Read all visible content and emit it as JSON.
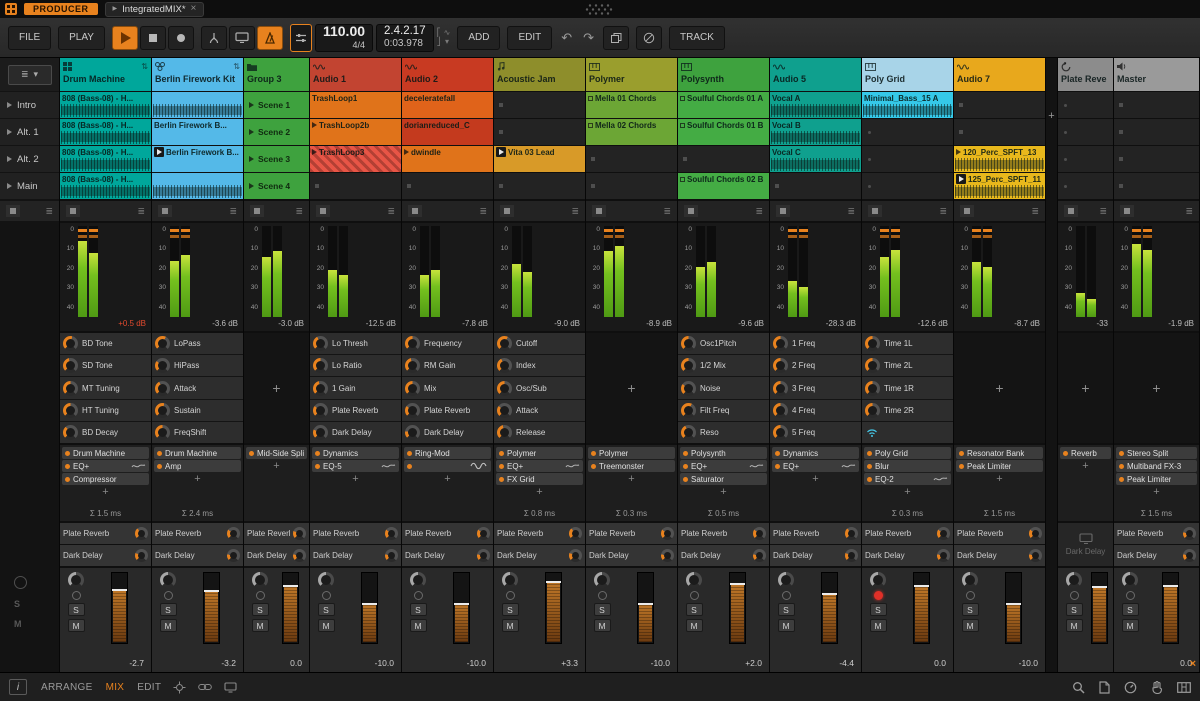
{
  "titlebar": {
    "badge": "PRODUCER",
    "tab": {
      "label": "IntegratedMIX*",
      "close": "×"
    }
  },
  "toolbar": {
    "file": "FILE",
    "play": "PLAY",
    "tempo": "110.00",
    "time_sig": "4/4",
    "position": "2.4.2.17",
    "time": "0:03.978",
    "add": "ADD",
    "edit": "EDIT",
    "track": "TRACK"
  },
  "glyphs": {
    "plus": "+",
    "scene_stop": "≣",
    "solo": "S",
    "mute": "M",
    "info": "i",
    "undo": "↶",
    "redo": "↷",
    "menu": "≣",
    "dropdown": "▾",
    "close": "×",
    "play_tri": "▶",
    "io": "⇅",
    "punch_in": "⎡",
    "punch_out": "⎦",
    "groove": "∿"
  },
  "meter_scale": [
    "0",
    "10",
    "20",
    "30",
    "40"
  ],
  "scenes": [
    "Intro",
    "Alt. 1",
    "Alt. 2",
    "Main"
  ],
  "statusbar": {
    "views": [
      {
        "label": "ARRANGE",
        "active": false
      },
      {
        "label": "MIX",
        "active": true
      },
      {
        "label": "EDIT",
        "active": false
      }
    ]
  },
  "tracks": [
    {
      "name": "Drum Machine",
      "kind": "instrument",
      "icon": "drum-machine",
      "color": "#00A79B",
      "io": true,
      "clips": [
        {
          "type": "clip",
          "label": "808 (Bass-08) - H...",
          "color": "#00A79B",
          "wave": true
        },
        {
          "type": "clip",
          "label": "808 (Bass-08) - H...",
          "color": "#00A79B",
          "wave": true
        },
        {
          "type": "clip",
          "label": "808 (Bass-08) - H...",
          "color": "#00A79B",
          "wave": true
        },
        {
          "type": "clip",
          "label": "808 (Bass-08) - H...",
          "color": "#00A79B",
          "wave": true
        }
      ],
      "meter": {
        "db": "+0.5 dB",
        "hot": true,
        "l": 0.84,
        "r": 0.7,
        "peak": true
      },
      "macros": [
        {
          "label": "BD Tone",
          "amt": 0.55
        },
        {
          "label": "SD Tone",
          "amt": 0.45
        },
        {
          "label": "MT Tuning",
          "amt": 0.5
        },
        {
          "label": "HT Tuning",
          "amt": 0.5
        },
        {
          "label": "BD Decay",
          "amt": 0.35
        }
      ],
      "devices": [
        {
          "label": "Drum Machine"
        },
        {
          "label": "EQ+",
          "eq": true
        },
        {
          "label": "Compressor"
        }
      ],
      "latency": "Σ 1.5 ms",
      "sends": [
        {
          "label": "Plate Reverb",
          "amt": 0.35
        },
        {
          "label": "Dark Delay",
          "amt": 0.25
        }
      ],
      "strip": {
        "value": "-2.7",
        "fader": 0.76,
        "armed": false
      }
    },
    {
      "name": "Berlin Firework Kit",
      "kind": "instrument",
      "icon": "drum-kit",
      "color": "#54B9E8",
      "io": true,
      "clips": [
        {
          "type": "clip",
          "label": "",
          "color": "#54B9E8",
          "wave": true
        },
        {
          "type": "clip",
          "label": "Berlin Firework B...",
          "color": "#54B9E8"
        },
        {
          "type": "clip",
          "label": "Berlin Firework B...",
          "color": "#54B9E8",
          "playing": true
        },
        {
          "type": "clip",
          "label": "",
          "color": "#54B9E8",
          "wave": true
        }
      ],
      "meter": {
        "db": "-3.6 dB",
        "l": 0.62,
        "r": 0.68,
        "peak": true
      },
      "macros": [
        {
          "label": "LoPass",
          "amt": 0.6
        },
        {
          "label": "HiPass",
          "amt": 0.3
        },
        {
          "label": "Attack",
          "amt": 0.4
        },
        {
          "label": "Sustain",
          "amt": 0.55
        },
        {
          "label": "FreqShift",
          "amt": 0.5
        }
      ],
      "devices": [
        {
          "label": "Drum Machine"
        },
        {
          "label": "Amp"
        }
      ],
      "latency": "Σ 2.4 ms",
      "sends": [
        {
          "label": "Plate Reverb",
          "amt": 0.3
        },
        {
          "label": "Dark Delay",
          "amt": 0.2
        }
      ],
      "strip": {
        "value": "-3.2",
        "fader": 0.75,
        "armed": false
      }
    },
    {
      "name": "Group 3",
      "kind": "group",
      "icon": "folder",
      "color": "#3EA23E",
      "clips": [
        {
          "type": "scene",
          "label": "Scene 1"
        },
        {
          "type": "scene",
          "label": "Scene 2"
        },
        {
          "type": "scene",
          "label": "Scene 3"
        },
        {
          "type": "scene",
          "label": "Scene 4"
        }
      ],
      "meter": {
        "db": "-3.0 dB",
        "l": 0.66,
        "r": 0.72
      },
      "macros": [],
      "devices": [
        {
          "label": "Mid-Side Split"
        }
      ],
      "latency": null,
      "sends": [
        {
          "label": "Plate Reverb",
          "amt": 0.25
        },
        {
          "label": "Dark Delay",
          "amt": 0.2
        }
      ],
      "strip": {
        "value": "0.0",
        "fader": 0.82,
        "armed": false
      }
    },
    {
      "name": "Audio 1",
      "kind": "audio",
      "icon": "audio",
      "color": "#C24431",
      "clips": [
        {
          "type": "clip",
          "label": "TrashLoop1",
          "color": "#E0731A"
        },
        {
          "type": "clip",
          "label": "TrashLoop2b",
          "color": "#E0731A",
          "arrow": true
        },
        {
          "type": "clip",
          "label": "TrashLoop3",
          "color": "#E85546",
          "arrow": true,
          "striped": true
        },
        {
          "type": "empty"
        }
      ],
      "meter": {
        "db": "-12.5 dB",
        "l": 0.52,
        "r": 0.46
      },
      "macros": [
        {
          "label": "Lo Thresh",
          "amt": 0.4
        },
        {
          "label": "Lo Ratio",
          "amt": 0.5
        },
        {
          "label": "1 Gain",
          "amt": 0.45
        },
        {
          "label": "Plate Reverb",
          "amt": 0.3
        },
        {
          "label": "Dark Delay",
          "amt": 0.25
        }
      ],
      "devices": [
        {
          "label": "Dynamics"
        },
        {
          "label": "EQ-5",
          "eq": true
        }
      ],
      "latency": null,
      "sends": [
        {
          "label": "Plate Reverb",
          "amt": 0.3
        },
        {
          "label": "Dark Delay",
          "amt": 0.2
        }
      ],
      "strip": {
        "value": "-10.0",
        "fader": 0.56,
        "armed": false
      }
    },
    {
      "name": "Audio 2",
      "kind": "audio",
      "icon": "audio",
      "color": "#C83A22",
      "clips": [
        {
          "type": "clip",
          "label": "deceleratefall",
          "color": "#E0631A"
        },
        {
          "type": "clip",
          "label": "dorianreduced_C",
          "color": "#C43A1E"
        },
        {
          "type": "clip",
          "label": "dwindle",
          "color": "#E0731A",
          "arrow": true
        },
        {
          "type": "empty"
        }
      ],
      "meter": {
        "db": "-7.8 dB",
        "l": 0.46,
        "r": 0.52
      },
      "macros": [
        {
          "label": "Frequency",
          "amt": 0.5
        },
        {
          "label": "RM Gain",
          "amt": 0.45
        },
        {
          "label": "Mix",
          "amt": 0.5
        },
        {
          "label": "Plate Reverb",
          "amt": 0.3
        },
        {
          "label": "Dark Delay",
          "amt": 0.2
        }
      ],
      "devices": [
        {
          "label": "Ring-Mod"
        },
        {
          "label": "",
          "icon": "sine"
        }
      ],
      "latency": null,
      "sends": [
        {
          "label": "Plate Reverb",
          "amt": 0.3
        },
        {
          "label": "Dark Delay",
          "amt": 0.2
        }
      ],
      "strip": {
        "value": "-10.0",
        "fader": 0.56,
        "armed": false
      }
    },
    {
      "name": "Acoustic Jam",
      "kind": "instrument",
      "icon": "note",
      "color": "#8E8E2B",
      "clips": [
        {
          "type": "empty"
        },
        {
          "type": "empty"
        },
        {
          "type": "clip",
          "label": "Vita 03 Lead",
          "color": "#D89A28",
          "playing": true
        },
        {
          "type": "empty"
        }
      ],
      "meter": {
        "db": "-9.0 dB",
        "l": 0.58,
        "r": 0.5
      },
      "macros": [
        {
          "label": "Cutoff",
          "amt": 0.6
        },
        {
          "label": "Index",
          "amt": 0.4
        },
        {
          "label": "Osc/Sub",
          "amt": 0.5
        },
        {
          "label": "Attack",
          "amt": 0.3
        },
        {
          "label": "Release",
          "amt": 0.45
        }
      ],
      "devices": [
        {
          "label": "Polymer"
        },
        {
          "label": "EQ+",
          "eq": true
        },
        {
          "label": "FX Grid"
        }
      ],
      "latency": "Σ 0.8 ms",
      "sends": [
        {
          "label": "Plate Reverb",
          "amt": 0.35
        },
        {
          "label": "Dark Delay",
          "amt": 0.25
        }
      ],
      "strip": {
        "value": "+3.3",
        "fader": 0.87,
        "armed": false
      }
    },
    {
      "name": "Polymer",
      "kind": "instrument",
      "icon": "synth",
      "color": "#9A9E2D",
      "clips": [
        {
          "type": "clip",
          "label": "Mella 01 Chords",
          "color": "#6CA635",
          "square": true
        },
        {
          "type": "clip",
          "label": "Mella 02 Chords",
          "color": "#6CA635",
          "square": true
        },
        {
          "type": "empty"
        },
        {
          "type": "empty"
        }
      ],
      "meter": {
        "db": "-8.9 dB",
        "l": 0.72,
        "r": 0.78,
        "peak": true
      },
      "macros": [],
      "devices": [
        {
          "label": "Polymer"
        },
        {
          "label": "Treemonster"
        }
      ],
      "latency": "Σ 0.3 ms",
      "sends": [
        {
          "label": "Plate Reverb",
          "amt": 0.3
        },
        {
          "label": "Dark Delay",
          "amt": 0.2
        }
      ],
      "strip": {
        "value": "-10.0",
        "fader": 0.56,
        "armed": false
      }
    },
    {
      "name": "Polysynth",
      "kind": "instrument",
      "icon": "synth",
      "color": "#3EA23E",
      "clips": [
        {
          "type": "clip",
          "label": "Soulful Chords 01 A",
          "color": "#44AC44",
          "square": true
        },
        {
          "type": "clip",
          "label": "Soulful Chords 01 B",
          "color": "#44AC44",
          "square": true
        },
        {
          "type": "empty"
        },
        {
          "type": "clip",
          "label": "Soulful Chords 02 B",
          "color": "#44AC44",
          "square": true
        }
      ],
      "meter": {
        "db": "-9.6 dB",
        "l": 0.55,
        "r": 0.6
      },
      "macros": [
        {
          "label": "Osc1Pitch",
          "amt": 0.5
        },
        {
          "label": "1/2 Mix",
          "amt": 0.5
        },
        {
          "label": "Noise",
          "amt": 0.3
        },
        {
          "label": "Filt Freq",
          "amt": 0.6
        },
        {
          "label": "Reso",
          "amt": 0.4
        }
      ],
      "devices": [
        {
          "label": "Polysynth"
        },
        {
          "label": "EQ+",
          "eq": true
        },
        {
          "label": "Saturator"
        }
      ],
      "latency": "Σ 0.5 ms",
      "sends": [
        {
          "label": "Plate Reverb",
          "amt": 0.3
        },
        {
          "label": "Dark Delay",
          "amt": 0.2
        }
      ],
      "strip": {
        "value": "+2.0",
        "fader": 0.85,
        "armed": false
      }
    },
    {
      "name": "Audio 5",
      "kind": "audio",
      "icon": "audio",
      "color": "#0FA08E",
      "clips": [
        {
          "type": "clip",
          "label": "Vocal A",
          "color": "#0FA08E",
          "wave": true
        },
        {
          "type": "clip",
          "label": "Vocal B",
          "color": "#0FA08E",
          "wave": true
        },
        {
          "type": "clip",
          "label": "Vocal C",
          "color": "#0FA08E",
          "wave": true
        },
        {
          "type": "empty"
        }
      ],
      "meter": {
        "db": "-28.3 dB",
        "l": 0.4,
        "r": 0.33,
        "peak": true
      },
      "macros": [
        {
          "label": "1 Freq",
          "amt": 0.5
        },
        {
          "label": "2 Freq",
          "amt": 0.5
        },
        {
          "label": "3 Freq",
          "amt": 0.5
        },
        {
          "label": "4 Freq",
          "amt": 0.5
        },
        {
          "label": "5 Freq",
          "amt": 0.5
        }
      ],
      "devices": [
        {
          "label": "Dynamics"
        },
        {
          "label": "EQ+",
          "eq": true
        }
      ],
      "latency": null,
      "sends": [
        {
          "label": "Plate Reverb",
          "amt": 0.35
        },
        {
          "label": "Dark Delay",
          "amt": 0.25
        }
      ],
      "strip": {
        "value": "-4.4",
        "fader": 0.7,
        "armed": false
      }
    },
    {
      "name": "Poly Grid",
      "kind": "instrument",
      "icon": "synth",
      "color": "#A8D4E8",
      "clips": [
        {
          "type": "clip",
          "label": "Minimal_Bass_15 A",
          "color": "#35C8E8",
          "wave": true
        },
        {
          "type": "empty",
          "dot": true
        },
        {
          "type": "empty",
          "dot": true
        },
        {
          "type": "empty",
          "dot": true
        }
      ],
      "meter": {
        "db": "-12.6 dB",
        "l": 0.66,
        "r": 0.74,
        "peak": true
      },
      "macros": [
        {
          "label": "Time 1L",
          "amt": 0.5
        },
        {
          "label": "Time 2L",
          "amt": 0.5
        },
        {
          "label": "Time 1R",
          "amt": 0.5
        },
        {
          "label": "Time 2R",
          "amt": 0.5
        },
        {
          "label": "",
          "icon": "wifi"
        }
      ],
      "devices": [
        {
          "label": "Poly Grid"
        },
        {
          "label": "Blur"
        },
        {
          "label": "EQ-2",
          "eq": true
        }
      ],
      "latency": "Σ 0.3 ms",
      "sends": [
        {
          "label": "Plate Reverb",
          "amt": 0.3
        },
        {
          "label": "Dark Delay",
          "amt": 0.2
        }
      ],
      "strip": {
        "value": "0.0",
        "fader": 0.82,
        "armed": true
      }
    },
    {
      "name": "Audio 7",
      "kind": "audio",
      "icon": "audio",
      "color": "#E8A81C",
      "clips": [
        {
          "type": "empty"
        },
        {
          "type": "empty"
        },
        {
          "type": "clip",
          "label": "120_Perc_SPFT_13",
          "color": "#E8B81C",
          "arrow": true,
          "wave": true
        },
        {
          "type": "clip",
          "label": "125_Perc_SPFT_11",
          "color": "#E8B81C",
          "playing": true,
          "wave": true
        }
      ],
      "meter": {
        "db": "-8.7 dB",
        "l": 0.6,
        "r": 0.55,
        "peak": true
      },
      "macros": [],
      "devices": [
        {
          "label": "Resonator Bank"
        },
        {
          "label": "Peak Limiter"
        }
      ],
      "latency": "Σ 1.5 ms",
      "sends": [
        {
          "label": "Plate Reverb",
          "amt": 0.3
        },
        {
          "label": "Dark Delay",
          "amt": 0.2
        }
      ],
      "strip": {
        "value": "-10.0",
        "fader": 0.56,
        "armed": false
      }
    },
    {
      "name": "Plate Reve",
      "kind": "fx",
      "icon": "fx",
      "color": "#8C8C8C",
      "clips": [
        {
          "type": "empty",
          "dot": true
        },
        {
          "type": "empty",
          "dot": true
        },
        {
          "type": "empty",
          "dot": true
        },
        {
          "type": "empty",
          "dot": true
        }
      ],
      "meter": {
        "db": "-33",
        "l": 0.26,
        "r": 0.2
      },
      "macros": [],
      "devices": [
        {
          "label": "Reverb"
        }
      ],
      "latency": null,
      "sends": [],
      "send_disabled": {
        "label": "Dark Delay"
      },
      "strip": {
        "value": "",
        "fader": 0.8,
        "armed": false
      }
    },
    {
      "name": "Master",
      "kind": "master",
      "icon": "master",
      "color": "#9A9A9A",
      "clips": [
        {
          "type": "empty"
        },
        {
          "type": "empty"
        },
        {
          "type": "empty"
        },
        {
          "type": "empty"
        }
      ],
      "meter": {
        "db": "-1.9 dB",
        "l": 0.8,
        "r": 0.74,
        "peak": true
      },
      "macros": [],
      "devices": [
        {
          "label": "Stereo Split"
        },
        {
          "label": "Multiband FX-3"
        },
        {
          "label": "Peak Limiter"
        }
      ],
      "latency": "Σ 1.5 ms",
      "sends": [
        {
          "label": "Plate Reverb",
          "amt": 0.2
        },
        {
          "label": "Dark Delay",
          "amt": 0.2
        }
      ],
      "strip": {
        "value": "0.0",
        "fader": 0.82,
        "armed": false
      }
    }
  ]
}
